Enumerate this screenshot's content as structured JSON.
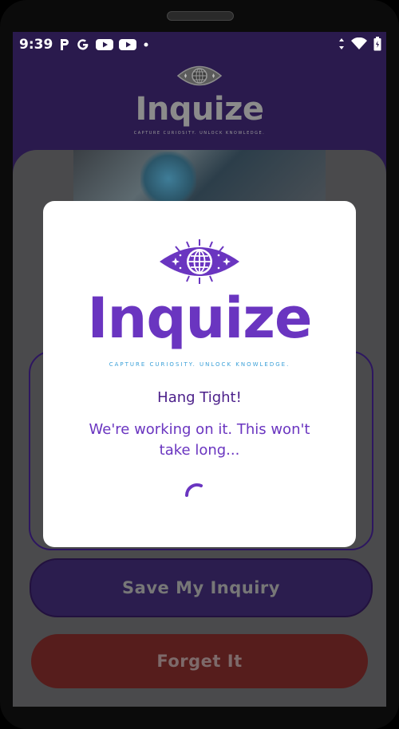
{
  "status_bar": {
    "time": "9:39",
    "left_icons": [
      "p-icon",
      "google-icon",
      "youtube-icon",
      "youtube-icon",
      "dot-icon"
    ],
    "right_icons": [
      "data-arrows-icon",
      "wifi-icon",
      "battery-icon"
    ]
  },
  "app": {
    "title": "Inquize",
    "tagline": "CAPTURE CURIOSITY. UNLOCK KNOWLEDGE.",
    "save_button": "Save My Inquiry",
    "forget_button": "Forget It"
  },
  "dialog": {
    "title": "Inquize",
    "tagline": "CAPTURE CURIOSITY. UNLOCK KNOWLEDGE.",
    "heading": "Hang Tight!",
    "message": "We're working on it. This won't take long..."
  },
  "colors": {
    "brand_purple": "#6a35c0",
    "tagline_blue": "#3aa0d8",
    "header_bg": "#2a1a4d",
    "save_button_bg": "#2b1d4e",
    "forget_button_bg": "#561d1c"
  }
}
